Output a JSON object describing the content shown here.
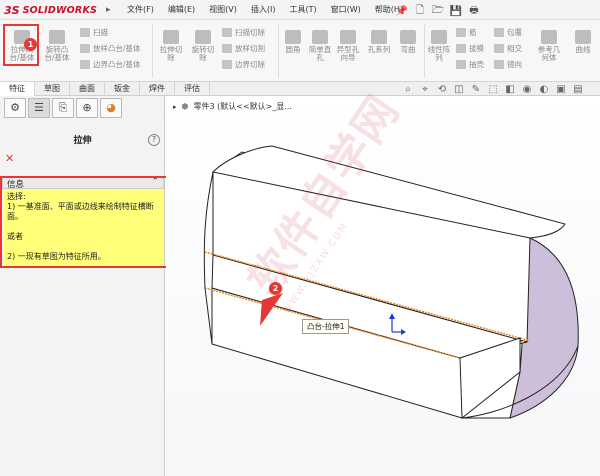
{
  "app": {
    "logo_mark": "3S",
    "logo_name": "SOLIDWORKS"
  },
  "menu": [
    "文件(F)",
    "编辑(E)",
    "视图(V)",
    "插入(I)",
    "工具(T)",
    "窗口(W)",
    "帮助(H)"
  ],
  "quick_access_icons": [
    "pin-icon",
    "new-file-icon",
    "open-file-icon",
    "save-icon",
    "print-icon"
  ],
  "ribbon": {
    "big_buttons": [
      {
        "label": "拉伸凸\n台/基体",
        "icon": "extrude-boss-icon"
      },
      {
        "label": "旋转凸\n台/基体",
        "icon": "revolve-boss-icon"
      },
      {
        "label": "拉伸切\n除",
        "icon": "extrude-cut-icon"
      },
      {
        "label": "旋转切\n除",
        "icon": "revolve-cut-icon"
      },
      {
        "label": "圆角",
        "icon": "fillet-icon"
      },
      {
        "label": "简单直\n孔",
        "icon": "simple-hole-icon"
      },
      {
        "label": "异型孔\n向导",
        "icon": "hole-wizard-icon"
      },
      {
        "label": "孔系列",
        "icon": "hole-series-icon"
      },
      {
        "label": "弯曲",
        "icon": "flex-icon"
      },
      {
        "label": "线性阵\n列",
        "icon": "linear-pattern-icon"
      },
      {
        "label": "参考几\n何体",
        "icon": "reference-geometry-icon"
      },
      {
        "label": "曲线",
        "icon": "curves-icon"
      }
    ],
    "small_buttons": [
      "扫描",
      "放样凸台/基体",
      "边界凸台/基体",
      "扫描切除",
      "放样切割",
      "边界切除",
      "筋",
      "拔模",
      "抽壳",
      "包覆",
      "相交",
      "镜向"
    ]
  },
  "tabs": [
    {
      "label": "特征",
      "active": true
    },
    {
      "label": "草图",
      "active": false
    },
    {
      "label": "曲面",
      "active": false
    },
    {
      "label": "钣金",
      "active": false
    },
    {
      "label": "焊件",
      "active": false
    },
    {
      "label": "评估",
      "active": false
    }
  ],
  "view_toolbar_icons": [
    "zoom-fit-icon",
    "zoom-area-icon",
    "previous-view-icon",
    "section-view-icon",
    "dynamic-annotation-icon",
    "view-orientation-icon",
    "display-style-icon",
    "hide-show-icon",
    "edit-appearance-icon",
    "scene-icon",
    "view-settings-icon"
  ],
  "panel": {
    "tab_icons": [
      "feature-manager-icon",
      "property-manager-icon",
      "configuration-manager-icon",
      "dimxpert-icon",
      "display-manager-icon"
    ],
    "title": "拉伸",
    "help": "?",
    "cancel": "✕",
    "info_header": "信息",
    "info_lines": [
      "选择:",
      "1) 一基准面、平面或边线来绘制特征横断",
      "面。",
      "",
      "或者",
      "",
      "2) 一现有草图为特征所用。"
    ]
  },
  "viewport": {
    "breadcrumb": "零件3  (默认<<默认>_显...",
    "tooltip": "凸台-拉伸1"
  },
  "callouts": [
    "1",
    "2"
  ],
  "watermark": "软件自学网",
  "watermark_url": "WWW.RJZXW.COM",
  "colors": {
    "callout": "#e53935",
    "info_bg": "#ffff7a",
    "edge_highlight": "#e8871e",
    "part_side": "#c9b8d6"
  }
}
